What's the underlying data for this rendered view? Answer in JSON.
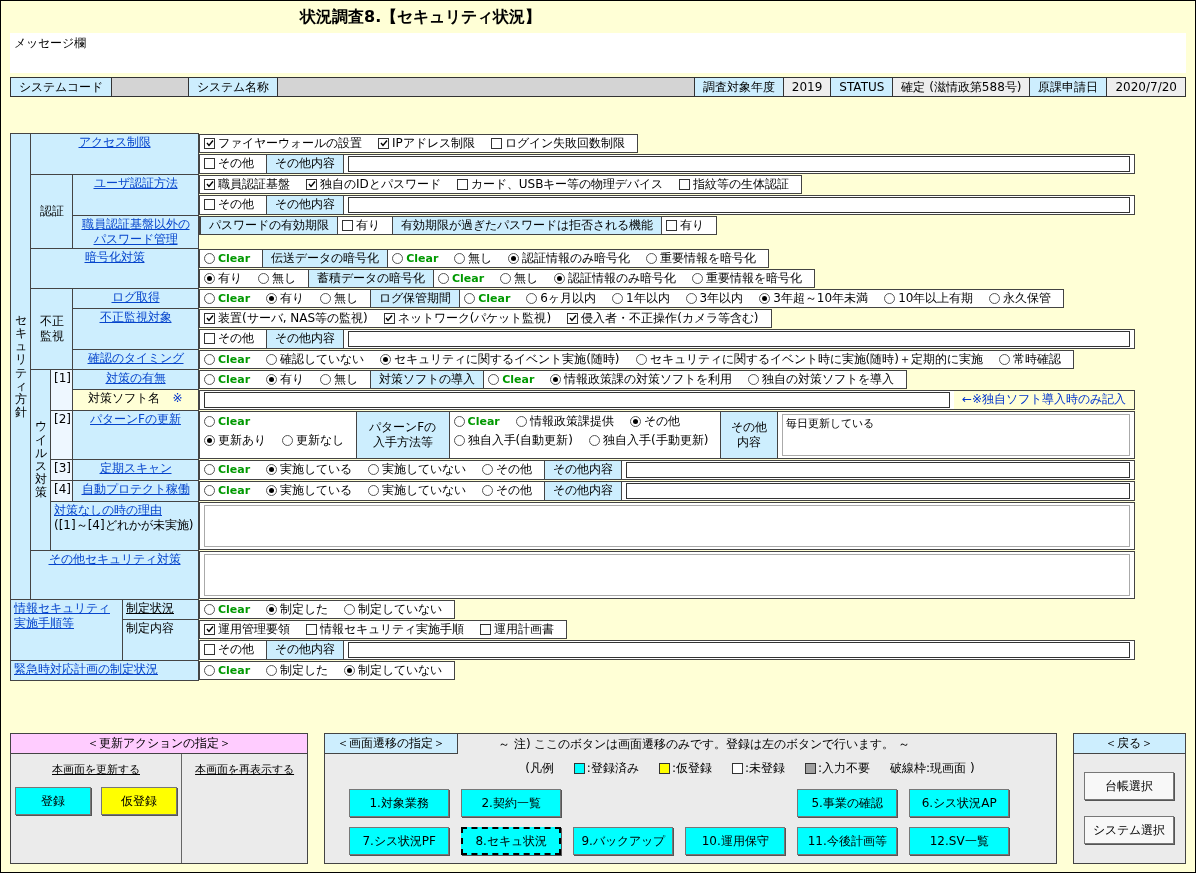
{
  "title": "状況調査8.【セキュリティ状況】",
  "message": {
    "label": "メッセージ欄"
  },
  "info_bar": [
    {
      "kind": "label",
      "text": "システムコード"
    },
    {
      "kind": "redacted"
    },
    {
      "kind": "label",
      "text": "システム名称"
    },
    {
      "kind": "redacted"
    },
    {
      "kind": "label",
      "text": "調査対象年度"
    },
    {
      "kind": "value",
      "text": "2019"
    },
    {
      "kind": "label",
      "text": "STATUS"
    },
    {
      "kind": "value",
      "text": "確定 (滋情政第588号)"
    },
    {
      "kind": "label",
      "text": "原課申請日"
    },
    {
      "kind": "value",
      "text": "2020/7/20"
    }
  ],
  "policy": {
    "label": "セキュリティ方針",
    "sections": [
      {
        "kind": "single",
        "label": "アクセス制限",
        "lines": [
          [
            {
              "kind": "check",
              "label": "ファイヤーウォールの設置",
              "checked": true
            },
            {
              "kind": "check",
              "label": "IPアドレス制限",
              "checked": true
            },
            {
              "kind": "check",
              "label": "ログイン失敗回数制限",
              "checked": false
            }
          ],
          [
            {
              "kind": "check",
              "label": "その他",
              "checked": false
            },
            {
              "kind": "field",
              "label": "その他内容"
            },
            {
              "kind": "input"
            }
          ]
        ]
      },
      {
        "kind": "group",
        "label": "認証",
        "items": [
          {
            "label": "ユーザ認証方法",
            "link": true,
            "lines": [
              [
                {
                  "kind": "check",
                  "label": "職員認証基盤",
                  "checked": true
                },
                {
                  "kind": "check",
                  "label": "独自のIDとパスワード",
                  "checked": true
                },
                {
                  "kind": "check",
                  "label": "カード、USBキー等の物理デバイス",
                  "checked": false
                },
                {
                  "kind": "check",
                  "label": "指紋等の生体認証",
                  "checked": false
                }
              ],
              [
                {
                  "kind": "check",
                  "label": "その他",
                  "checked": false
                },
                {
                  "kind": "field",
                  "label": "その他内容"
                },
                {
                  "kind": "input"
                }
              ]
            ]
          },
          {
            "label": "職員認証基盤以外のパスワード管理",
            "link": true,
            "lines": [
              [
                {
                  "kind": "field",
                  "label": "パスワードの有効期限"
                },
                {
                  "kind": "check",
                  "label": "有り",
                  "checked": false
                },
                {
                  "kind": "field",
                  "label": "有効期限が過ぎたパスワードは拒否される機能"
                },
                {
                  "kind": "check",
                  "label": "有り",
                  "checked": false
                }
              ]
            ]
          }
        ]
      },
      {
        "kind": "single",
        "label": "暗号化対策",
        "lines": [
          [
            {
              "kind": "clear",
              "label": "Clear",
              "selected": false
            },
            {
              "kind": "field",
              "label": "伝送データの暗号化"
            },
            {
              "kind": "clear",
              "label": "Clear",
              "selected": false
            },
            {
              "kind": "radio",
              "label": "無し",
              "selected": false
            },
            {
              "kind": "radio",
              "label": "認証情報のみ暗号化",
              "selected": true
            },
            {
              "kind": "radio",
              "label": "重要情報を暗号化",
              "selected": false
            }
          ],
          [
            {
              "kind": "radio",
              "label": "有り",
              "selected": true
            },
            {
              "kind": "radio",
              "label": "無し",
              "selected": false
            },
            {
              "kind": "field",
              "label": "蓄積データの暗号化"
            },
            {
              "kind": "clear",
              "label": "Clear",
              "selected": false
            },
            {
              "kind": "radio",
              "label": "無し",
              "selected": false
            },
            {
              "kind": "radio",
              "label": "認証情報のみ暗号化",
              "selected": true
            },
            {
              "kind": "radio",
              "label": "重要情報を暗号化",
              "selected": false
            }
          ]
        ]
      },
      {
        "kind": "group",
        "label": "不正監視",
        "items": [
          {
            "label": "ログ取得",
            "link": true,
            "lines": [
              [
                {
                  "kind": "clear",
                  "label": "Clear",
                  "selected": false
                },
                {
                  "kind": "radio",
                  "label": "有り",
                  "selected": true
                },
                {
                  "kind": "radio",
                  "label": "無し",
                  "selected": false
                },
                {
                  "kind": "field",
                  "label": "ログ保管期間"
                },
                {
                  "kind": "clear",
                  "label": "Clear",
                  "selected": false
                },
                {
                  "kind": "radio",
                  "label": "6ヶ月以内",
                  "selected": false
                },
                {
                  "kind": "radio",
                  "label": "1年以内",
                  "selected": false
                },
                {
                  "kind": "radio",
                  "label": "3年以内",
                  "selected": false
                },
                {
                  "kind": "radio",
                  "label": "3年超～10年未満",
                  "selected": true
                },
                {
                  "kind": "radio",
                  "label": "10年以上有期",
                  "selected": false
                },
                {
                  "kind": "radio",
                  "label": "永久保管",
                  "selected": false
                }
              ]
            ]
          },
          {
            "label": "不正監視対象",
            "link": true,
            "lines": [
              [
                {
                  "kind": "check",
                  "label": "装置(サーバ, NAS等の監視)",
                  "checked": true
                },
                {
                  "kind": "check",
                  "label": "ネットワーク(パケット監視)",
                  "checked": true
                },
                {
                  "kind": "check",
                  "label": "侵入者・不正操作(カメラ等含む)",
                  "checked": true
                }
              ],
              [
                {
                  "kind": "check",
                  "label": "その他",
                  "checked": false
                },
                {
                  "kind": "field",
                  "label": "その他内容"
                },
                {
                  "kind": "input"
                }
              ]
            ]
          },
          {
            "label": "確認のタイミング",
            "link": true,
            "lines": [
              [
                {
                  "kind": "clear",
                  "label": "Clear",
                  "selected": false
                },
                {
                  "kind": "radio",
                  "label": "確認していない",
                  "selected": false
                },
                {
                  "kind": "radio",
                  "label": "セキュリティに関するイベント実施(随時)",
                  "selected": true
                },
                {
                  "kind": "radio",
                  "label": "セキュリティに関するイベント時に実施(随時)＋定期的に実施",
                  "selected": false
                },
                {
                  "kind": "radio",
                  "label": "常時確認",
                  "selected": false
                }
              ]
            ]
          }
        ]
      },
      {
        "kind": "virus",
        "label": "ウイルス対策",
        "items": [
          {
            "index": "[1]",
            "label": "対策の有無",
            "link": true,
            "lines": [
              [
                {
                  "kind": "clear",
                  "label": "Clear",
                  "selected": false
                },
                {
                  "kind": "radio",
                  "label": "有り",
                  "selected": true
                },
                {
                  "kind": "radio",
                  "label": "無し",
                  "selected": false
                },
                {
                  "kind": "field",
                  "label": "対策ソフトの導入"
                },
                {
                  "kind": "clear",
                  "label": "Clear",
                  "selected": false
                },
                {
                  "kind": "radio",
                  "label": "情報政策課の対策ソフトを利用",
                  "selected": true
                },
                {
                  "kind": "radio",
                  "label": "独自の対策ソフトを導入",
                  "selected": false
                }
              ]
            ]
          },
          {
            "label": "対策ソフト名",
            "mark": "※",
            "link": false,
            "lines": [
              [
                {
                  "kind": "input"
                },
                {
                  "kind": "note",
                  "text": "←※独自ソフト導入時のみ記入"
                }
              ]
            ]
          },
          {
            "index": "[2]",
            "label": "パターンFの更新",
            "link": true,
            "lines": [
              [
                {
                  "kind": "stack",
                  "lines": [
                    [
                      {
                        "kind": "clear",
                        "label": "Clear",
                        "selected": false
                      }
                    ],
                    [
                      {
                        "kind": "radio",
                        "label": "更新あり",
                        "selected": true
                      },
                      {
                        "kind": "radio",
                        "label": "更新なし",
                        "selected": false
                      }
                    ]
                  ]
                },
                {
                  "kind": "field",
                  "label": "パターンFの入手方法等"
                },
                {
                  "kind": "stack",
                  "lines": [
                    [
                      {
                        "kind": "clear",
                        "label": "Clear",
                        "selected": false
                      },
                      {
                        "kind": "radio",
                        "label": "情報政策課提供",
                        "selected": false
                      },
                      {
                        "kind": "radio",
                        "label": "その他",
                        "selected": true
                      }
                    ],
                    [
                      {
                        "kind": "radio",
                        "label": "独自入手(自動更新)",
                        "selected": false
                      },
                      {
                        "kind": "radio",
                        "label": "独自入手(手動更新)",
                        "selected": false
                      }
                    ]
                  ]
                },
                {
                  "kind": "field",
                  "label": "その他内容"
                },
                {
                  "kind": "textarea",
                  "value": "毎日更新している"
                }
              ]
            ]
          },
          {
            "index": "[3]",
            "label": "定期スキャン",
            "link": true,
            "lines": [
              [
                {
                  "kind": "clear",
                  "label": "Clear",
                  "selected": false
                },
                {
                  "kind": "radio",
                  "label": "実施している",
                  "selected": true
                },
                {
                  "kind": "radio",
                  "label": "実施していない",
                  "selected": false
                },
                {
                  "kind": "radio",
                  "label": "その他",
                  "selected": false
                },
                {
                  "kind": "field",
                  "label": "その他内容"
                },
                {
                  "kind": "input"
                }
              ]
            ]
          },
          {
            "index": "[4]",
            "label": "自動プロテクト稼働",
            "link": true,
            "lines": [
              [
                {
                  "kind": "clear",
                  "label": "Clear",
                  "selected": false
                },
                {
                  "kind": "radio",
                  "label": "実施している",
                  "selected": true
                },
                {
                  "kind": "radio",
                  "label": "実施していない",
                  "selected": false
                },
                {
                  "kind": "radio",
                  "label": "その他",
                  "selected": false
                },
                {
                  "kind": "field",
                  "label": "その他内容"
                },
                {
                  "kind": "input"
                }
              ]
            ]
          }
        ],
        "reason": {
          "label": "対策なしの時の理由",
          "sublabel": "([1]～[4]どれかが未実施)",
          "lines": [
            [
              {
                "kind": "textarea"
              }
            ]
          ]
        }
      },
      {
        "kind": "single",
        "label": "その他セキュリティ対策",
        "lines": [
          [
            {
              "kind": "textarea"
            }
          ]
        ]
      }
    ]
  },
  "outer_sections": [
    {
      "kind": "group",
      "label": "情報セキュリティ実施手順等",
      "items": [
        {
          "label": "制定状況",
          "link": true,
          "lines": [
            [
              {
                "kind": "clear",
                "label": "Clear",
                "selected": false
              },
              {
                "kind": "radio",
                "label": "制定した",
                "selected": true
              },
              {
                "kind": "radio",
                "label": "制定していない",
                "selected": false
              }
            ]
          ]
        },
        {
          "label": "制定内容",
          "link": false,
          "lines": [
            [
              {
                "kind": "check",
                "label": "運用管理要領",
                "checked": true
              },
              {
                "kind": "check",
                "label": "情報セキュリティ実施手順",
                "checked": false
              },
              {
                "kind": "check",
                "label": "運用計画書",
                "checked": false
              }
            ],
            [
              {
                "kind": "check",
                "label": "その他",
                "checked": false
              },
              {
                "kind": "field",
                "label": "その他内容"
              },
              {
                "kind": "input"
              }
            ]
          ]
        }
      ]
    },
    {
      "kind": "single",
      "label": "緊急時対応計画の制定状況",
      "lines": [
        [
          {
            "kind": "clear",
            "label": "Clear",
            "selected": false
          },
          {
            "kind": "radio",
            "label": "制定した",
            "selected": false
          },
          {
            "kind": "radio",
            "label": "制定していない",
            "selected": true
          }
        ]
      ]
    }
  ],
  "update_panel": {
    "title": "＜更新アクションの指定＞",
    "columns": [
      {
        "heading": "本画面を更新する",
        "buttons": [
          {
            "label": "登録",
            "color": "#00ffff",
            "current": false
          },
          {
            "label": "仮登録",
            "color": "#ffff00",
            "current": false
          }
        ]
      },
      {
        "heading": "本画面を再表示する"
      }
    ]
  },
  "navigation_panel": {
    "title": "＜画面遷移の指定＞",
    "note": "～ 注) ここのボタンは画面遷移のみです。登録は左のボタンで行います。 ～",
    "legend": {
      "open": "(凡例",
      "items": [
        {
          "text": ":登録済み",
          "color": "#00ffff"
        },
        {
          "text": ":仮登録",
          "color": "#ffff00"
        },
        {
          "text": ":未登録",
          "color": "#ffffff"
        },
        {
          "text": ":入力不要",
          "color": "#a0a0a0"
        }
      ],
      "close": "破線枠:現画面 )"
    },
    "rows": [
      [
        {
          "kind": "button",
          "label": "1.対象業務",
          "color": "#00ffff",
          "current": false
        },
        {
          "kind": "button",
          "label": "2.契約一覧",
          "color": "#00ffff",
          "current": false
        },
        {
          "kind": "empty"
        },
        {
          "kind": "empty"
        },
        {
          "kind": "button",
          "label": "5.事業の確認",
          "color": "#00ffff",
          "current": false
        },
        {
          "kind": "button",
          "label": "6.シス状況AP",
          "color": "#00ffff",
          "current": false
        }
      ],
      [
        {
          "kind": "button",
          "label": "7.シス状況PF",
          "color": "#00ffff",
          "current": false
        },
        {
          "kind": "button",
          "label": "8.セキュ状況",
          "color": "#00ffff",
          "current": true
        },
        {
          "kind": "button",
          "label": "9.バックアップ",
          "color": "#00ffff",
          "current": false
        },
        {
          "kind": "button",
          "label": "10.運用保守",
          "color": "#00ffff",
          "current": false
        },
        {
          "kind": "button",
          "label": "11.今後計画等",
          "color": "#00ffff",
          "current": false
        },
        {
          "kind": "button",
          "label": "12.SV一覧",
          "color": "#00ffff",
          "current": false
        }
      ]
    ]
  },
  "back_panel": {
    "title": "＜戻る＞",
    "buttons": [
      {
        "label": "台帳選択",
        "color": "#f8f8f8",
        "current": false
      },
      {
        "label": "システム選択",
        "color": "#f8f8f8",
        "current": false
      }
    ]
  }
}
